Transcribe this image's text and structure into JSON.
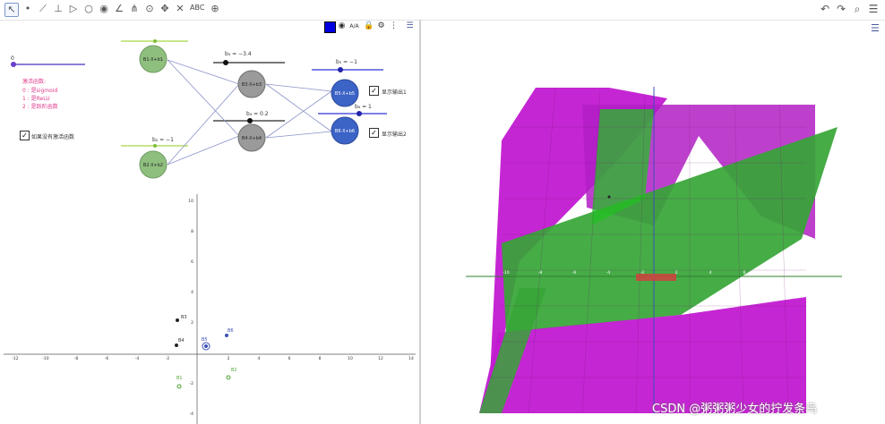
{
  "toolbar": {
    "tools": [
      "move-tool",
      "point-tool",
      "line-tool",
      "perpendicular-tool",
      "polygon-tool",
      "circle-tool",
      "conic-tool",
      "angle-tool",
      "reflect-tool",
      "slider-tool",
      "move-graphics-tool",
      "rotate-tool",
      "intersect-tool"
    ],
    "text_tool_label": "ABC",
    "right": [
      "undo-icon",
      "redo-icon",
      "search-icon",
      "menu-icon"
    ]
  },
  "graphics": {
    "title": "激活函数",
    "activation_options": [
      "激活函数:",
      "0 : 是sigmoid",
      "1 : 是ReLU",
      "2 : 是跃阶函数"
    ],
    "slider_a_value": "0",
    "checkbox_no_activation": "如果没有激活函数",
    "checkbox_output1": "显示输出1",
    "checkbox_output2": "显示输出2",
    "slider_b3": "b₃ = −3.4",
    "slider_b4": "b₄ = 0.2",
    "slider_b5": "b₅ = −1",
    "slider_b6": "b₆ = 1",
    "slider_b2": "b₂ = −1",
    "nodes": {
      "n1": "B1·X+b1",
      "n2": "B2·X+b2",
      "n3": "B3·X+b3",
      "n4": "B4·X+b4",
      "n5": "B5·X+b5",
      "n6": "B6·X+b6"
    },
    "x_ticks": [
      "-12",
      "-10",
      "-8",
      "-6",
      "-4",
      "-2",
      "",
      "2",
      "4",
      "6",
      "8",
      "10",
      "12",
      "14"
    ],
    "y_ticks": [
      "10",
      "8",
      "6",
      "4",
      "2",
      "",
      "-2",
      "-4"
    ],
    "points": [
      "B3",
      "B4",
      "B5",
      "B6",
      "B1",
      "B2"
    ]
  },
  "view3d": {
    "axis_ticks": [
      "-10",
      "-8",
      "-6",
      "-4",
      "-2",
      "2",
      "4",
      "6",
      "8"
    ],
    "colors": {
      "surface1": "#c21ad1",
      "surface2": "#28a828"
    }
  },
  "watermark": "CSDN @粥粥粥少女的拧发条鸟",
  "colors": {
    "accent": "#3b4fb8",
    "node_green": "#8fbf7f",
    "node_gray": "#9a9a9a",
    "node_blue": "#3c63c6"
  }
}
